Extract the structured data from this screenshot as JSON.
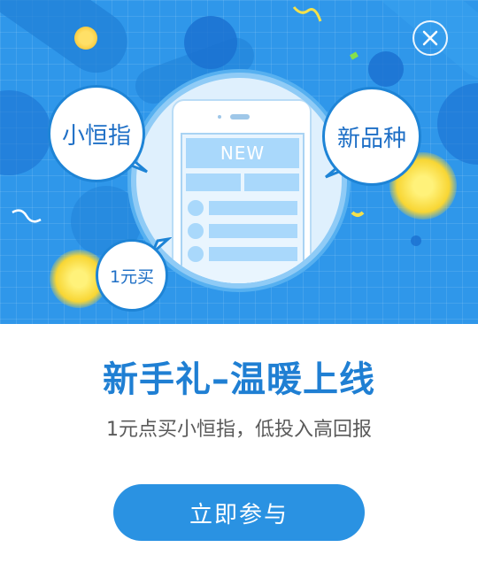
{
  "banner": {
    "bubble_left": "小恒指",
    "bubble_right": "新品种",
    "bubble_bottom": "1元买",
    "phone_screen_label": "NEW"
  },
  "content": {
    "headline": "新手礼–温暖上线",
    "subline": "1元点买小恒指，低投入高回报"
  },
  "actions": {
    "join_label": "立即参与"
  },
  "colors": {
    "banner_bg": "#2f97ea",
    "accent": "#1f7fd3",
    "button": "#2a92e2"
  },
  "icons": {
    "close": "close-icon",
    "coin": "gold-coin-icon"
  }
}
